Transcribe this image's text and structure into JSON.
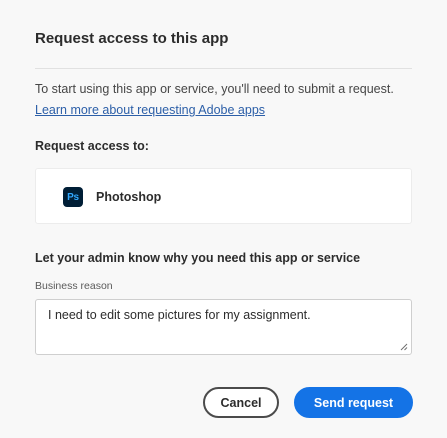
{
  "dialog": {
    "title": "Request access to this app",
    "intro_text": "To start using this app or service, you'll need to submit a request.",
    "learn_more_link": "Learn more about requesting Adobe apps",
    "request_access_label": "Request access to:",
    "app": {
      "icon_text": "Ps",
      "icon": "photoshop-icon",
      "name": "Photoshop"
    },
    "reason_heading": "Let your admin know why you need this app or service",
    "reason_field_label": "Business reason",
    "reason_value": "I need to edit some pictures for my assignment.",
    "cancel_label": "Cancel",
    "send_label": "Send request"
  },
  "colors": {
    "accent": "#1473e6",
    "link": "#2c5fa8",
    "photoshop_bg": "#001e36",
    "photoshop_fg": "#31a8ff"
  }
}
